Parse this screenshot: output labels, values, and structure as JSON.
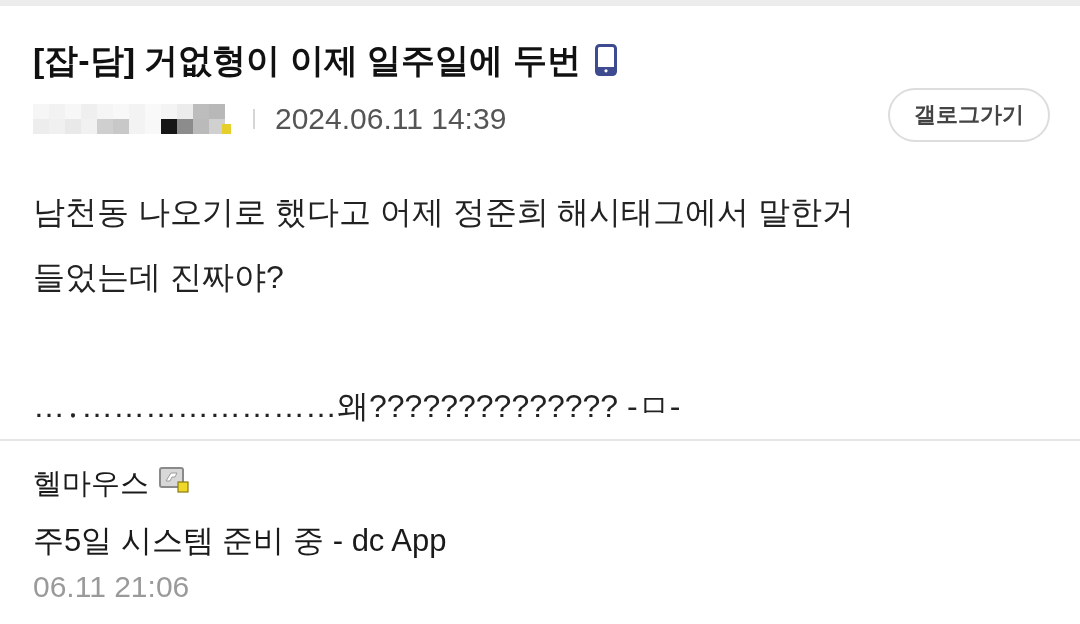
{
  "post": {
    "title": "[잡-담] 거없형이 이제 일주일에 두번",
    "date": "2024.06.11 14:39",
    "gallog_button": "갤로그가기",
    "paragraphs": [
      [
        "남천동 나오기로 했다고 어제 정준희 해시태그에서 말한거",
        "들었는데 진짜야?"
      ],
      [
        "…․……………………왜?????????????? -ㅁ-"
      ]
    ]
  },
  "comments": [
    {
      "nickname": "헬마우스",
      "text": "주5일 시스템 준비 중 - dc App",
      "time": "06.11 21:06"
    }
  ]
}
